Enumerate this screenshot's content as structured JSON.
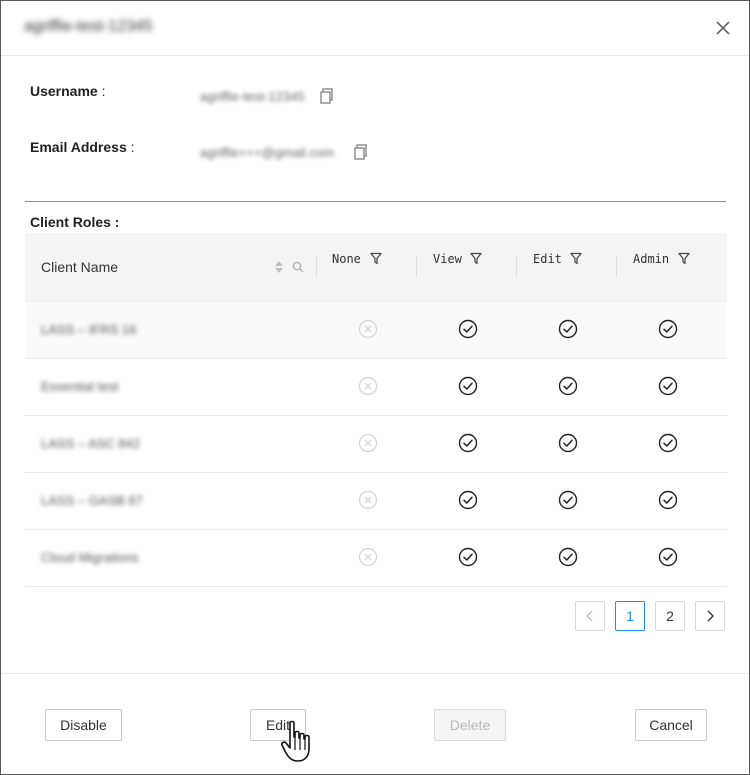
{
  "dialog": {
    "title": "agriffie-test-12345",
    "close_icon": "close-icon"
  },
  "info": {
    "username_label": "Username",
    "username_value": "agriffie-test-12345",
    "email_label": "Email Address",
    "email_value": "agriffie+++@gmail.com",
    "colon": " :"
  },
  "roles": {
    "section_label": "Client Roles :",
    "headers": {
      "client_name": "Client Name",
      "none": "None",
      "view": "View",
      "edit": "Edit",
      "admin": "Admin"
    },
    "rows": [
      {
        "client_name": "LASS – IFRS 16",
        "none": "disabled",
        "view": "check",
        "edit": "check",
        "admin": "check"
      },
      {
        "client_name": "Essential test",
        "none": "disabled",
        "view": "check",
        "edit": "check",
        "admin": "check"
      },
      {
        "client_name": "LASS – ASC 842",
        "none": "disabled",
        "view": "check",
        "edit": "check",
        "admin": "check"
      },
      {
        "client_name": "LASS – GASB 87",
        "none": "disabled",
        "view": "check",
        "edit": "check",
        "admin": "check"
      },
      {
        "client_name": "Cloud Migrations",
        "none": "disabled",
        "view": "check",
        "edit": "check",
        "admin": "check"
      }
    ]
  },
  "pagination": {
    "prev_icon": "chevron-left-icon",
    "pages": [
      "1",
      "2"
    ],
    "current_page": "1",
    "next_icon": "chevron-right-icon"
  },
  "footer": {
    "disable_label": "Disable",
    "edit_label": "Edit",
    "delete_label": "Delete",
    "cancel_label": "Cancel"
  },
  "colors": {
    "accent": "#1890ff",
    "border": "#5a5a5a",
    "header_bg": "#f4f4f4"
  }
}
